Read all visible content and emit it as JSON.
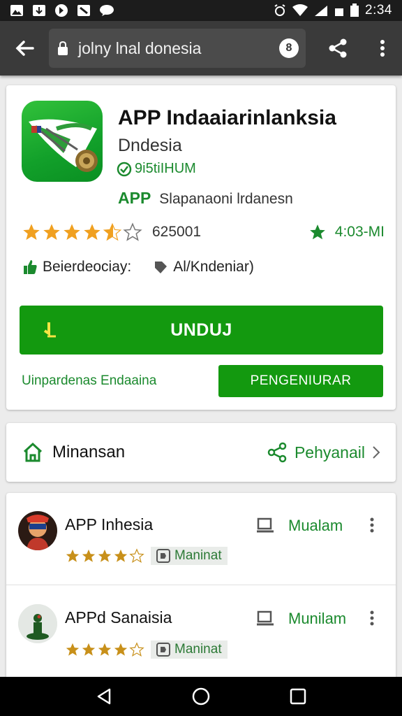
{
  "status_bar": {
    "time": "2:34"
  },
  "browser": {
    "url": "jolny lnal  donesia",
    "badge": "8"
  },
  "app": {
    "title": "APP Indaaiarinlanksia",
    "developer": "Dndesia",
    "verified": "9i5tiIHUM",
    "category_label": "APP",
    "category_value": "Slapanaoni lrdanesn",
    "rating_count": "625001",
    "installs": "4:03-MI",
    "meta_1": "Beierdeociay:",
    "meta_2": "Al/Kndeniar)",
    "install_label": "UNDUJ",
    "secondary_link": "Uinpardenas Endaaina",
    "secondary_button": "PENGENIURAR",
    "rating_stars": 4.5
  },
  "share_card": {
    "left_label": "Minansan",
    "right_label": "Pehyanail"
  },
  "list": {
    "items": [
      {
        "title": "APP Inhesia",
        "tag": "Maninat",
        "action": "Mualam",
        "stars": 4.5
      },
      {
        "title": "APPd Sanaisia",
        "tag": "Maninat",
        "action": "Munilam",
        "stars": 4
      }
    ]
  },
  "colors": {
    "accent_green": "#13990f",
    "text_green": "#1b8a2e",
    "star_orange": "#f0a020",
    "toolbar": "#3a3a3a"
  }
}
